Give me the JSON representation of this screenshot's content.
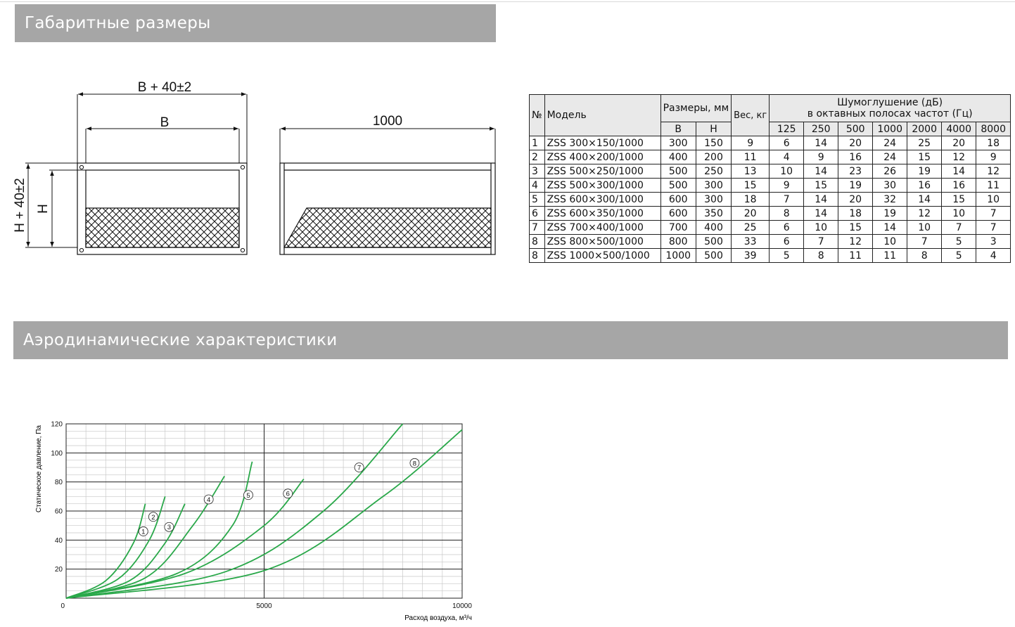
{
  "sections": {
    "dimensions_title": "Габаритные размеры",
    "aero_title": "Аэродинамические характеристики"
  },
  "drawing": {
    "outer_width_label": "B + 40±2",
    "inner_width_label": "B",
    "length_label": "1000",
    "outer_height_label": "H + 40±2",
    "inner_height_label": "H"
  },
  "table": {
    "col_no": "№",
    "col_model": "Модель",
    "col_size": "Размеры, мм",
    "col_b": "B",
    "col_h": "H",
    "col_weight": "Вес, кг",
    "col_noise_line1": "Шумоглушение (дБ)",
    "col_noise_line2": "в октавных полосах частот (Гц)",
    "freqs": [
      "125",
      "250",
      "500",
      "1000",
      "2000",
      "4000",
      "8000"
    ],
    "rows": [
      {
        "no": "1",
        "model": "ZSS 300×150/1000",
        "b": "300",
        "h": "150",
        "w": "9",
        "att": [
          "6",
          "14",
          "20",
          "24",
          "25",
          "20",
          "18"
        ]
      },
      {
        "no": "2",
        "model": "ZSS 400×200/1000",
        "b": "400",
        "h": "200",
        "w": "11",
        "att": [
          "4",
          "9",
          "16",
          "24",
          "15",
          "12",
          "9"
        ]
      },
      {
        "no": "3",
        "model": "ZSS 500×250/1000",
        "b": "500",
        "h": "250",
        "w": "13",
        "att": [
          "10",
          "14",
          "23",
          "26",
          "19",
          "14",
          "12"
        ]
      },
      {
        "no": "4",
        "model": "ZSS 500×300/1000",
        "b": "500",
        "h": "300",
        "w": "15",
        "att": [
          "9",
          "15",
          "19",
          "30",
          "16",
          "16",
          "11"
        ]
      },
      {
        "no": "5",
        "model": "ZSS 600×300/1000",
        "b": "600",
        "h": "300",
        "w": "18",
        "att": [
          "7",
          "14",
          "20",
          "32",
          "14",
          "15",
          "10"
        ]
      },
      {
        "no": "6",
        "model": "ZSS 600×350/1000",
        "b": "600",
        "h": "350",
        "w": "20",
        "att": [
          "8",
          "14",
          "18",
          "19",
          "12",
          "10",
          "7"
        ]
      },
      {
        "no": "7",
        "model": "ZSS 700×400/1000",
        "b": "700",
        "h": "400",
        "w": "25",
        "att": [
          "6",
          "10",
          "15",
          "14",
          "10",
          "7",
          "7"
        ]
      },
      {
        "no": "8",
        "model": "ZSS 800×500/1000",
        "b": "800",
        "h": "500",
        "w": "33",
        "att": [
          "6",
          "7",
          "12",
          "10",
          "7",
          "5",
          "3"
        ]
      },
      {
        "no": "8",
        "model": "ZSS 1000×500/1000",
        "b": "1000",
        "h": "500",
        "w": "39",
        "att": [
          "5",
          "8",
          "11",
          "11",
          "8",
          "5",
          "4"
        ]
      }
    ]
  },
  "chart_data": {
    "type": "line",
    "xlabel": "Расход воздуха, м³/ч",
    "ylabel": "Статическое давление, Па",
    "xlim": [
      0,
      10000
    ],
    "ylim": [
      0,
      120
    ],
    "x_ticks": [
      0,
      5000,
      10000
    ],
    "y_ticks": [
      20,
      40,
      60,
      80,
      100,
      120
    ],
    "grid": true,
    "line_color": "#2aa84a",
    "series": [
      {
        "name": "1",
        "points": [
          [
            0,
            0
          ],
          [
            1000,
            12
          ],
          [
            1700,
            38
          ],
          [
            2000,
            65
          ]
        ],
        "label_at": [
          1950,
          46
        ]
      },
      {
        "name": "2",
        "points": [
          [
            0,
            0
          ],
          [
            1300,
            13
          ],
          [
            2100,
            40
          ],
          [
            2500,
            70
          ]
        ],
        "label_at": [
          2200,
          56
        ]
      },
      {
        "name": "3",
        "points": [
          [
            0,
            0
          ],
          [
            1600,
            12
          ],
          [
            2500,
            38
          ],
          [
            3000,
            65
          ]
        ],
        "label_at": [
          2600,
          49
        ]
      },
      {
        "name": "4",
        "points": [
          [
            0,
            0
          ],
          [
            2000,
            14
          ],
          [
            3200,
            50
          ],
          [
            4000,
            84
          ]
        ],
        "label_at": [
          3600,
          68
        ]
      },
      {
        "name": "5",
        "points": [
          [
            0,
            0
          ],
          [
            2800,
            17
          ],
          [
            4200,
            50
          ],
          [
            4700,
            94
          ]
        ],
        "label_at": [
          4600,
          71
        ]
      },
      {
        "name": "6",
        "points": [
          [
            0,
            0
          ],
          [
            3000,
            17
          ],
          [
            5000,
            50
          ],
          [
            6000,
            82
          ]
        ],
        "label_at": [
          5600,
          72
        ]
      },
      {
        "name": "7",
        "points": [
          [
            0,
            0
          ],
          [
            4000,
            18
          ],
          [
            6500,
            60
          ],
          [
            8500,
            120
          ]
        ],
        "label_at": [
          7400,
          90
        ]
      },
      {
        "name": "8",
        "points": [
          [
            0,
            0
          ],
          [
            5000,
            19
          ],
          [
            8000,
            70
          ],
          [
            10000,
            116
          ]
        ],
        "label_at": [
          8800,
          93
        ]
      }
    ]
  }
}
